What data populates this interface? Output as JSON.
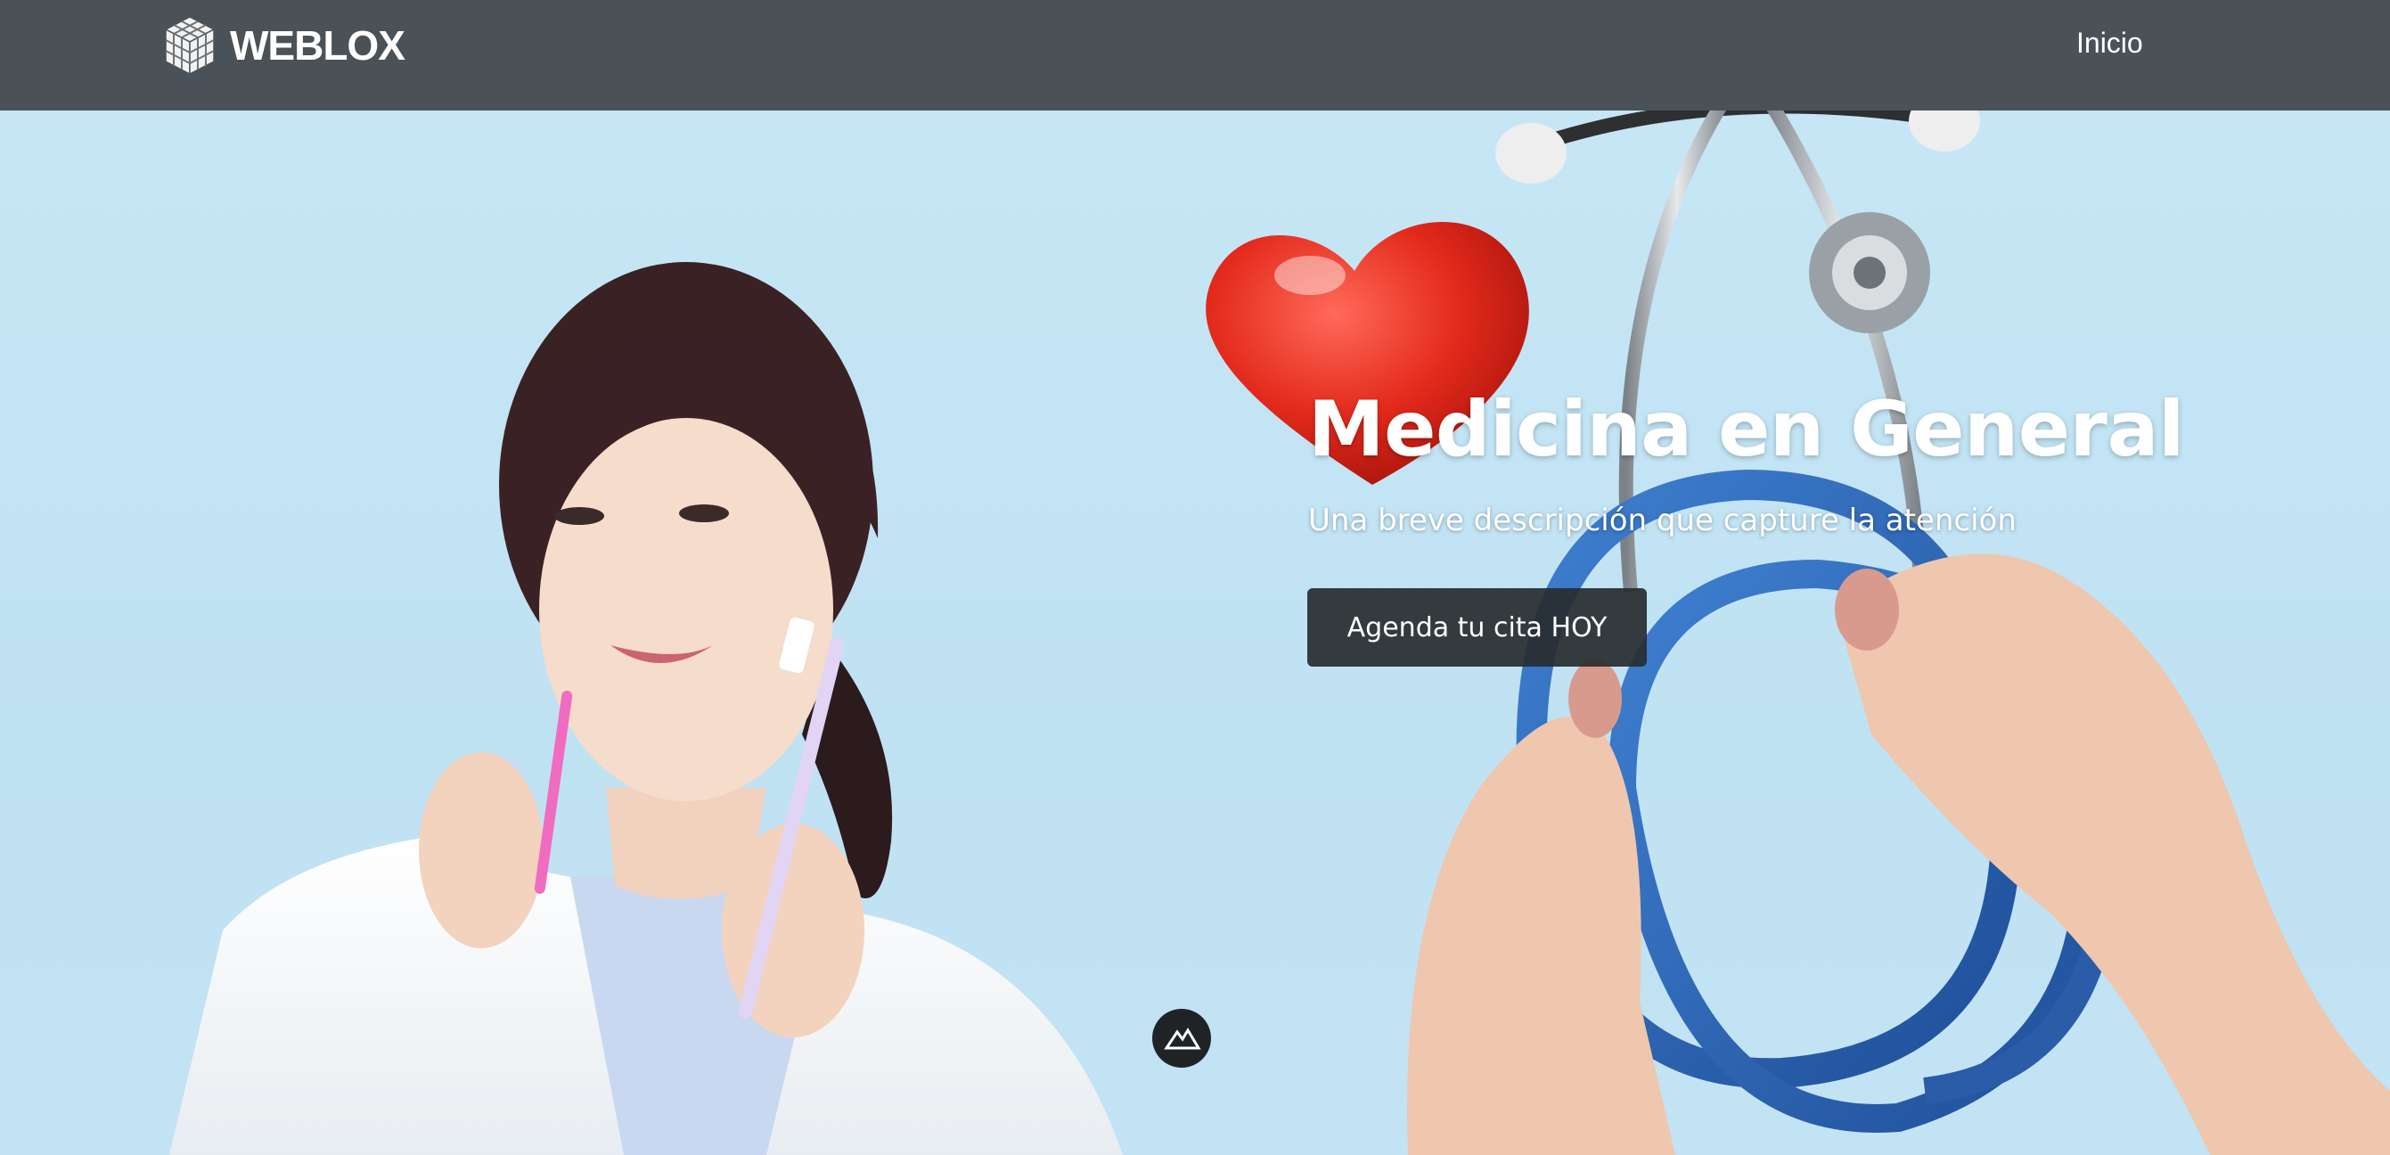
{
  "navbar": {
    "brand_name": "WEBLOX",
    "links": [
      {
        "label": "Inicio"
      }
    ]
  },
  "hero": {
    "title": "Medicina en General",
    "subtitle": "Una breve descripción que capture la atención",
    "cta_label": "Agenda tu cita HOY"
  },
  "colors": {
    "navbar_bg": "#4b5257",
    "hero_bg": "#c4e5f4",
    "button_bg": "#282c2f",
    "text_light": "#ffffff"
  },
  "icons": {
    "brand_logo": "cube-logo-icon",
    "bottom_badge": "mountain-icon"
  }
}
